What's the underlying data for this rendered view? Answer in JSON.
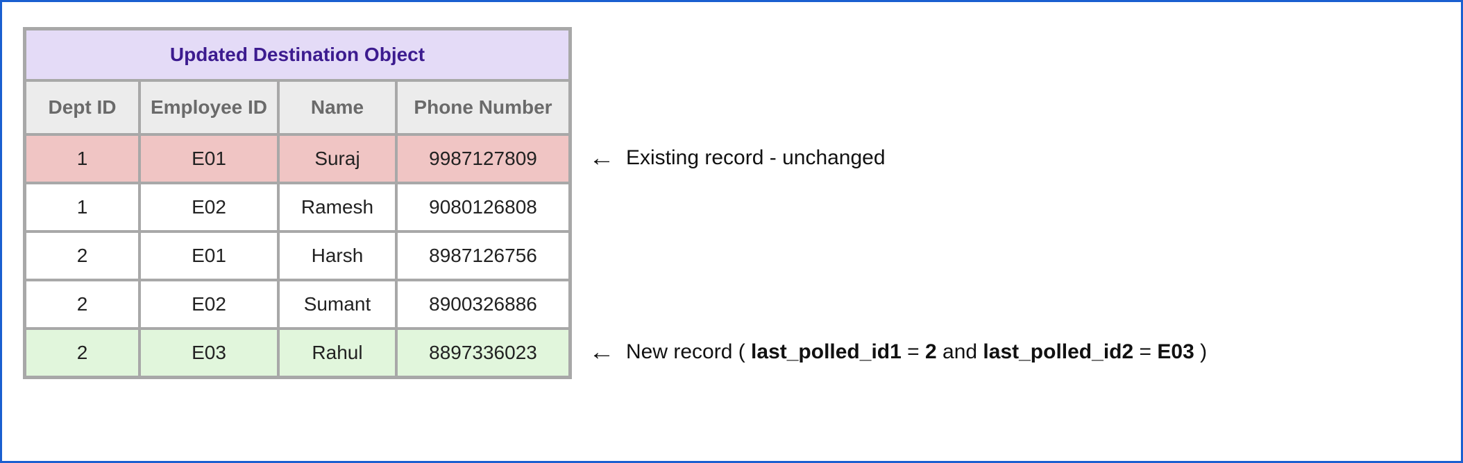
{
  "table": {
    "title": "Updated Destination Object",
    "columns": [
      "Dept ID",
      "Employee ID",
      "Name",
      "Phone Number"
    ],
    "rows": [
      {
        "dept": "1",
        "emp": "E01",
        "name": "Suraj",
        "phone": "9987127809",
        "highlight": "pink"
      },
      {
        "dept": "1",
        "emp": "E02",
        "name": "Ramesh",
        "phone": "9080126808",
        "highlight": ""
      },
      {
        "dept": "2",
        "emp": "E01",
        "name": "Harsh",
        "phone": "8987126756",
        "highlight": ""
      },
      {
        "dept": "2",
        "emp": "E02",
        "name": "Sumant",
        "phone": "8900326886",
        "highlight": ""
      },
      {
        "dept": "2",
        "emp": "E03",
        "name": "Rahul",
        "phone": "8897336023",
        "highlight": "green"
      }
    ]
  },
  "annotations": {
    "row0": {
      "arrow": "←",
      "text": "Existing record - unchanged"
    },
    "row4": {
      "arrow": "←",
      "prefix": "New record ( ",
      "k1": "last_polled_id1",
      "eq1": " = ",
      "v1": "2",
      "mid": " and ",
      "k2": "last_polled_id2",
      "eq2": " = ",
      "v2": "E03",
      "suffix": " )"
    }
  }
}
